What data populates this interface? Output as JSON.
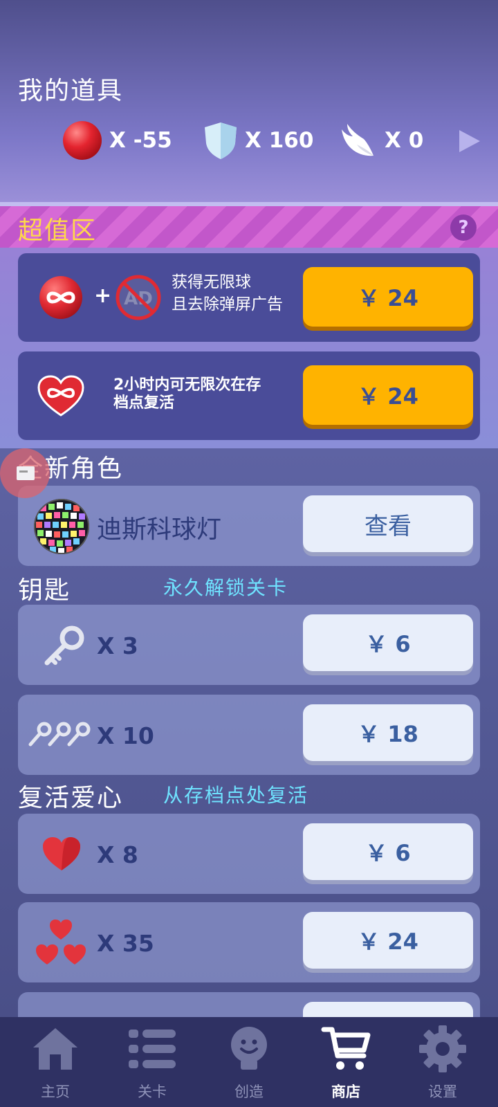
{
  "header": {
    "title": "我的道具",
    "inventory": [
      {
        "icon": "red-ball-icon",
        "count": "X -55"
      },
      {
        "icon": "shield-icon",
        "count": "X 160"
      },
      {
        "icon": "wing-icon",
        "count": "X 0"
      }
    ]
  },
  "super_zone": {
    "title": "超值区",
    "help": "?",
    "offers": [
      {
        "line1": "获得无限球",
        "line2": "且去除弹屏广告",
        "price": "￥ 24",
        "ad_text": "AD"
      },
      {
        "line1": "2小时内可无限次在存",
        "line2": "档点复活",
        "price": "￥ 24"
      }
    ]
  },
  "characters": {
    "title": "全新角色",
    "items": [
      {
        "name": "迪斯科球灯",
        "button": "查看"
      }
    ]
  },
  "keys": {
    "title": "钥匙",
    "subtitle": "永久解锁关卡",
    "items": [
      {
        "qty": "X 3",
        "price": "￥ 6"
      },
      {
        "qty": "X 10",
        "price": "￥ 18"
      }
    ]
  },
  "hearts": {
    "title": "复活爱心",
    "subtitle": "从存档点处复活",
    "items": [
      {
        "qty": "X 8",
        "price": "￥ 6"
      },
      {
        "qty": "X 35",
        "price": "￥ 24"
      }
    ]
  },
  "nav": {
    "items": [
      {
        "label": "主页",
        "icon": "home-icon"
      },
      {
        "label": "关卡",
        "icon": "list-icon"
      },
      {
        "label": "创造",
        "icon": "lightbulb-icon"
      },
      {
        "label": "商店",
        "icon": "cart-icon",
        "active": true
      },
      {
        "label": "设置",
        "icon": "gear-icon"
      }
    ]
  },
  "colors": {
    "gold_button": "#ffb300",
    "accent_cyan": "#6fe3ff",
    "title_yellow": "#ffd84a",
    "nav_bg": "#2f3163"
  }
}
